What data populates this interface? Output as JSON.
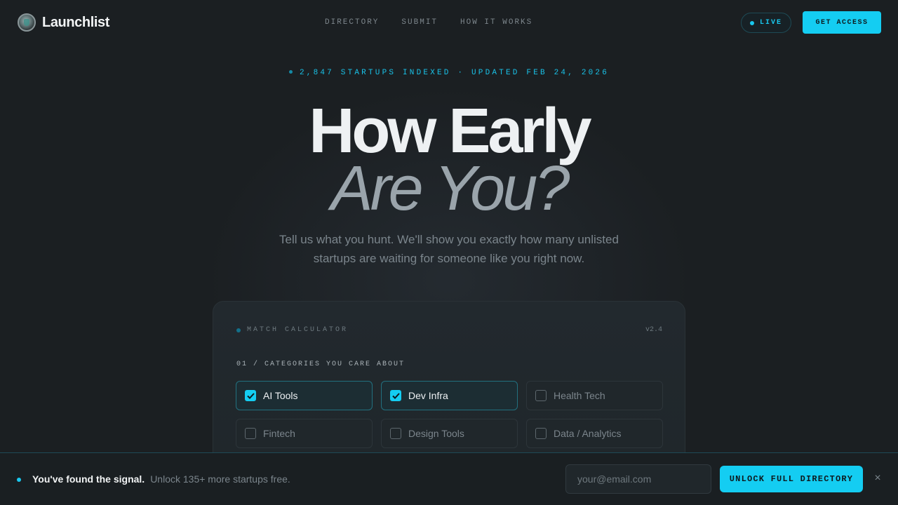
{
  "nav": {
    "brand": "Launchlist",
    "links": [
      "DIRECTORY",
      "SUBMIT",
      "HOW IT WORKS"
    ],
    "live_label": "LIVE",
    "cta": "GET ACCESS"
  },
  "hero": {
    "stats": "2,847 STARTUPS INDEXED · UPDATED FEB 24, 2026",
    "title_line1": "How Early",
    "title_line2": "Are You?",
    "subtitle": "Tell us what you hunt. We'll show you exactly how many unlisted startups are waiting for someone like you right now."
  },
  "calculator": {
    "title": "MATCH CALCULATOR",
    "version": "v2.4",
    "section_label": "01 / CATEGORIES YOU CARE ABOUT",
    "categories": [
      {
        "label": "AI Tools",
        "checked": true
      },
      {
        "label": "Dev Infra",
        "checked": true
      },
      {
        "label": "Health Tech",
        "checked": false
      },
      {
        "label": "Fintech",
        "checked": false
      },
      {
        "label": "Design Tools",
        "checked": false
      },
      {
        "label": "Data / Analytics",
        "checked": false
      }
    ]
  },
  "signup_bar": {
    "headline": "You've found the signal.",
    "subtext": "Unlock 135+ more startups free.",
    "email_placeholder": "your@email.com",
    "cta": "UNLOCK FULL DIRECTORY",
    "close_icon": "×"
  },
  "colors": {
    "accent": "#14cdf2",
    "background": "#1b1f22"
  }
}
